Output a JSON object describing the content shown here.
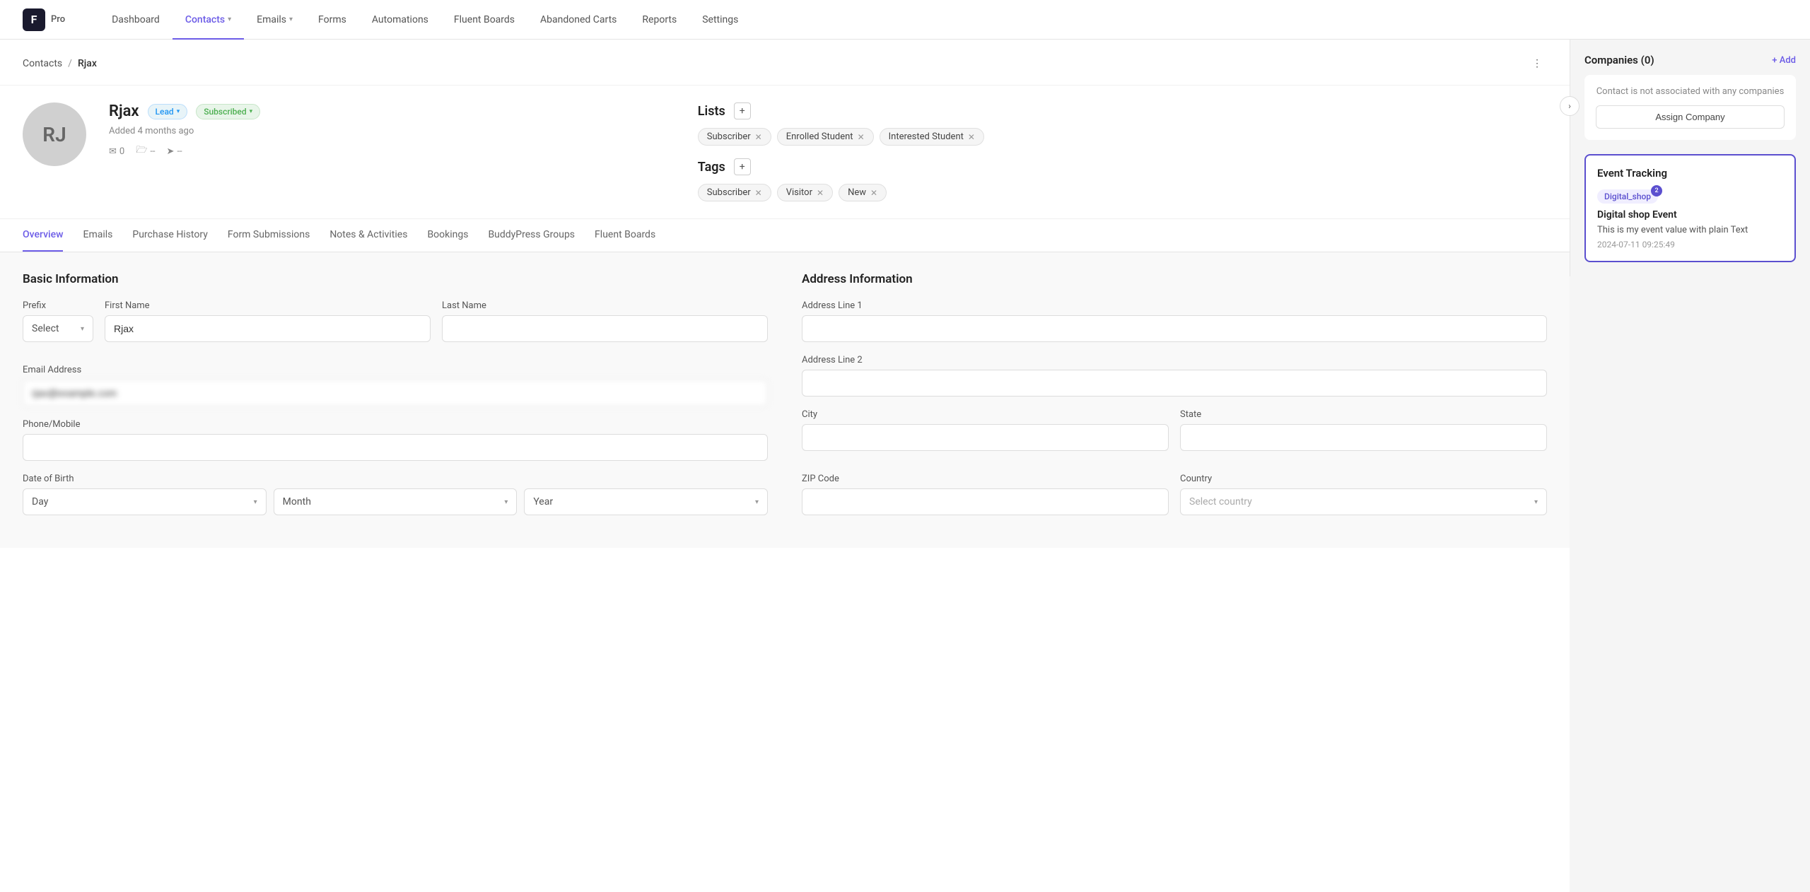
{
  "app": {
    "logo_text": "F",
    "plan": "Pro"
  },
  "nav": {
    "items": [
      {
        "label": "Dashboard",
        "active": false,
        "has_dropdown": false
      },
      {
        "label": "Contacts",
        "active": true,
        "has_dropdown": true
      },
      {
        "label": "Emails",
        "active": false,
        "has_dropdown": true
      },
      {
        "label": "Forms",
        "active": false,
        "has_dropdown": false
      },
      {
        "label": "Automations",
        "active": false,
        "has_dropdown": false
      },
      {
        "label": "Fluent Boards",
        "active": false,
        "has_dropdown": false
      },
      {
        "label": "Abandoned Carts",
        "active": false,
        "has_dropdown": false
      },
      {
        "label": "Reports",
        "active": false,
        "has_dropdown": false
      },
      {
        "label": "Settings",
        "active": false,
        "has_dropdown": false
      }
    ]
  },
  "breadcrumb": {
    "parent": "Contacts",
    "separator": "/",
    "current": "Rjax"
  },
  "contact": {
    "initials": "RJ",
    "name": "Rjax",
    "lead_badge": "Lead",
    "subscribed_badge": "Subscribed",
    "added_text": "Added 4 months ago",
    "email_count": "0",
    "folder_count": "--",
    "send_count": "--"
  },
  "lists": {
    "title": "Lists",
    "add_label": "+",
    "items": [
      {
        "label": "Subscriber"
      },
      {
        "label": "Enrolled Student"
      },
      {
        "label": "Interested Student"
      }
    ]
  },
  "tags": {
    "title": "Tags",
    "add_label": "+",
    "items": [
      {
        "label": "Subscriber"
      },
      {
        "label": "Visitor"
      },
      {
        "label": "New"
      }
    ]
  },
  "tabs": [
    {
      "label": "Overview",
      "active": true
    },
    {
      "label": "Emails",
      "active": false
    },
    {
      "label": "Purchase History",
      "active": false
    },
    {
      "label": "Form Submissions",
      "active": false
    },
    {
      "label": "Notes & Activities",
      "active": false
    },
    {
      "label": "Bookings",
      "active": false
    },
    {
      "label": "BuddyPress Groups",
      "active": false
    },
    {
      "label": "Fluent Boards",
      "active": false
    }
  ],
  "basic_info": {
    "title": "Basic Information",
    "prefix_label": "Prefix",
    "prefix_placeholder": "Select",
    "first_name_label": "First Name",
    "first_name_value": "Rjax",
    "last_name_label": "Last Name",
    "last_name_value": "",
    "email_label": "Email Address",
    "email_value": "",
    "phone_label": "Phone/Mobile",
    "phone_value": "",
    "dob_label": "Date of Birth",
    "dob_day": "Day",
    "dob_month": "Month",
    "dob_year": "Year"
  },
  "address_info": {
    "title": "Address Information",
    "line1_label": "Address Line 1",
    "line1_value": "",
    "line2_label": "Address Line 2",
    "line2_value": "",
    "city_label": "City",
    "city_value": "",
    "state_label": "State",
    "state_value": "",
    "zip_label": "ZIP Code",
    "zip_value": "",
    "country_label": "Country",
    "country_placeholder": "Select country"
  },
  "right_panel": {
    "companies_title": "Companies (0)",
    "add_link": "+ Add",
    "no_company_text": "Contact is not associated with any companies",
    "assign_btn": "Assign Company",
    "event_tracking_title": "Event Tracking",
    "event": {
      "tag": "Digital_shop",
      "badge": "2",
      "name": "Digital shop Event",
      "description": "This is my event value with plain Text",
      "timestamp": "2024-07-11 09:25:49"
    }
  }
}
